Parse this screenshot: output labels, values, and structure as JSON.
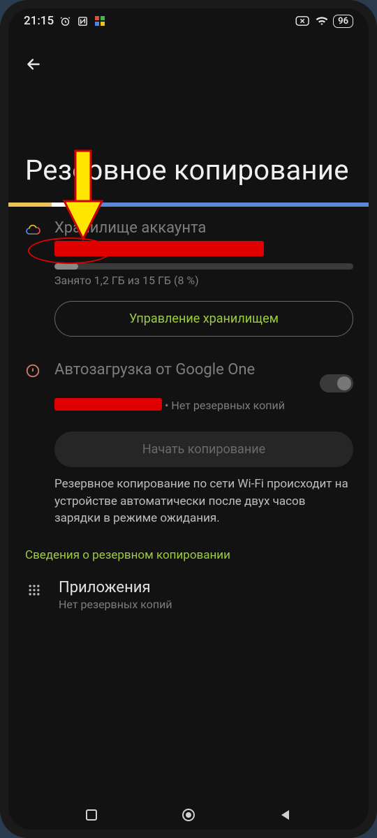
{
  "statusbar": {
    "time": "21:15",
    "battery": "96"
  },
  "page": {
    "title": "Резервное копирование"
  },
  "storage": {
    "section_title": "Хранилище аккаунта",
    "usage_text": "Занято 1,2 ГБ из 15 ГБ (8 %)",
    "usage_percent": 8,
    "manage_label": "Управление хранилищем"
  },
  "backup": {
    "section_title": "Автозагрузка от Google One",
    "no_backups_suffix": " • Нет резервных копий",
    "start_label": "Начать копирование",
    "info_text": "Резервное копирование по сети Wi-Fi происходит на устройстве автоматически после двух часов зарядки в режиме ожидания."
  },
  "details": {
    "link_label": "Сведения о резервном копировании",
    "apps_title": "Приложения",
    "apps_sub": "Нет резервных копий"
  }
}
